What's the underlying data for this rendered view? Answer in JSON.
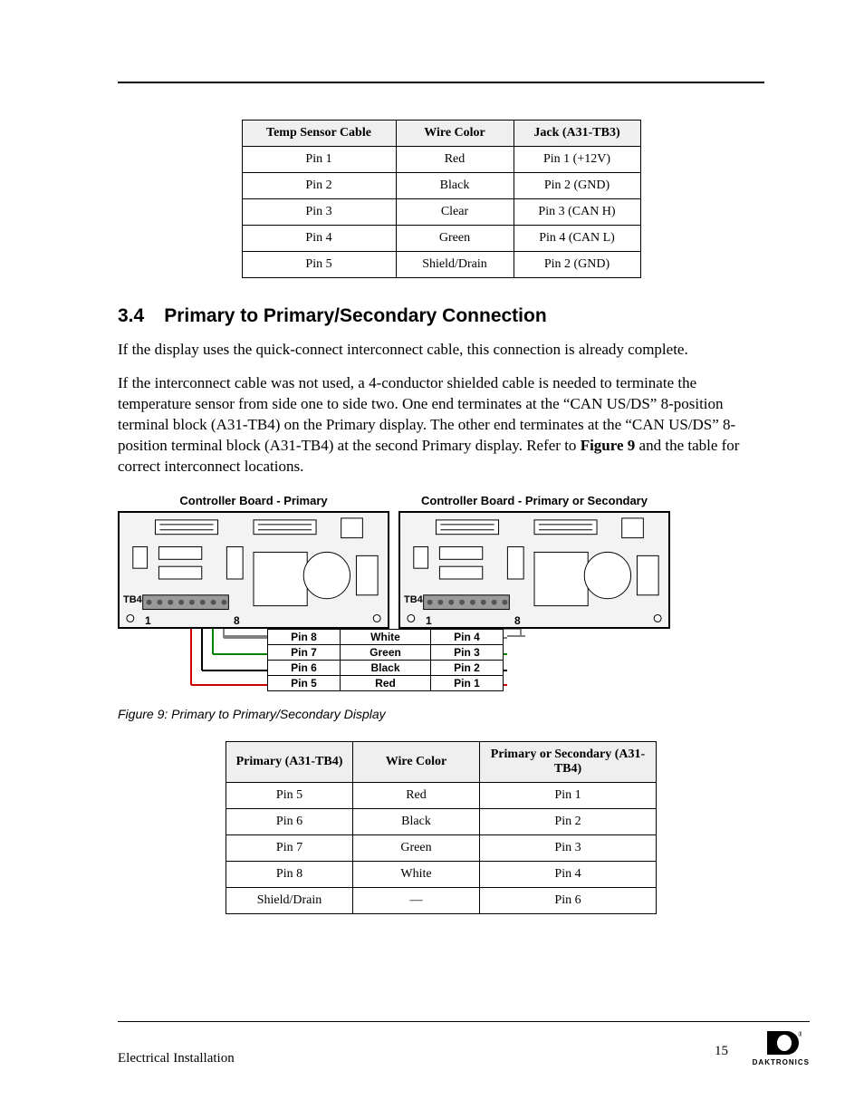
{
  "table1": {
    "headers": [
      "Temp Sensor Cable",
      "Wire Color",
      "Jack (A31-TB3)"
    ],
    "rows": [
      [
        "Pin 1",
        "Red",
        "Pin 1 (+12V)"
      ],
      [
        "Pin 2",
        "Black",
        "Pin 2 (GND)"
      ],
      [
        "Pin 3",
        "Clear",
        "Pin 3 (CAN H)"
      ],
      [
        "Pin 4",
        "Green",
        "Pin 4 (CAN L)"
      ],
      [
        "Pin 5",
        "Shield/Drain",
        "Pin 2 (GND)"
      ]
    ]
  },
  "section": {
    "number": "3.4",
    "title": "Primary to Primary/Secondary Connection"
  },
  "paragraphs": {
    "p1": "If the display uses the quick-connect interconnect cable, this connection is already complete.",
    "p2a": "If the interconnect cable was not used, a 4-conductor shielded cable is needed to terminate the temperature sensor from side one to side two. One end terminates at the “CAN US/DS” 8-position terminal block (A31-TB4) on the Primary display. The other end terminates at the “CAN US/DS” 8-position terminal block (A31-TB4) at the second Primary display. Refer to ",
    "p2b": "Figure 9",
    "p2c": " and the table for correct interconnect locations."
  },
  "boards": {
    "left_title": "Controller Board - Primary",
    "right_title": "Controller Board - Primary or Secondary",
    "tb4": "TB4",
    "one": "1",
    "eight": "8"
  },
  "wire_table": [
    [
      "Pin 8",
      "White",
      "Pin 4"
    ],
    [
      "Pin 7",
      "Green",
      "Pin 3"
    ],
    [
      "Pin 6",
      "Black",
      "Pin 2"
    ],
    [
      "Pin 5",
      "Red",
      "Pin 1"
    ]
  ],
  "figure_caption": "Figure 9: Primary to Primary/Secondary Display",
  "table2": {
    "headers": [
      "Primary (A31-TB4)",
      "Wire Color",
      "Primary or Secondary (A31-TB4)"
    ],
    "rows": [
      [
        "Pin 5",
        "Red",
        "Pin 1"
      ],
      [
        "Pin 6",
        "Black",
        "Pin 2"
      ],
      [
        "Pin 7",
        "Green",
        "Pin 3"
      ],
      [
        "Pin 8",
        "White",
        "Pin 4"
      ],
      [
        "Shield/Drain",
        "—",
        "Pin 6"
      ]
    ]
  },
  "footer": {
    "text": "Electrical Installation",
    "page": "15",
    "brand": "DAKTRONICS"
  }
}
